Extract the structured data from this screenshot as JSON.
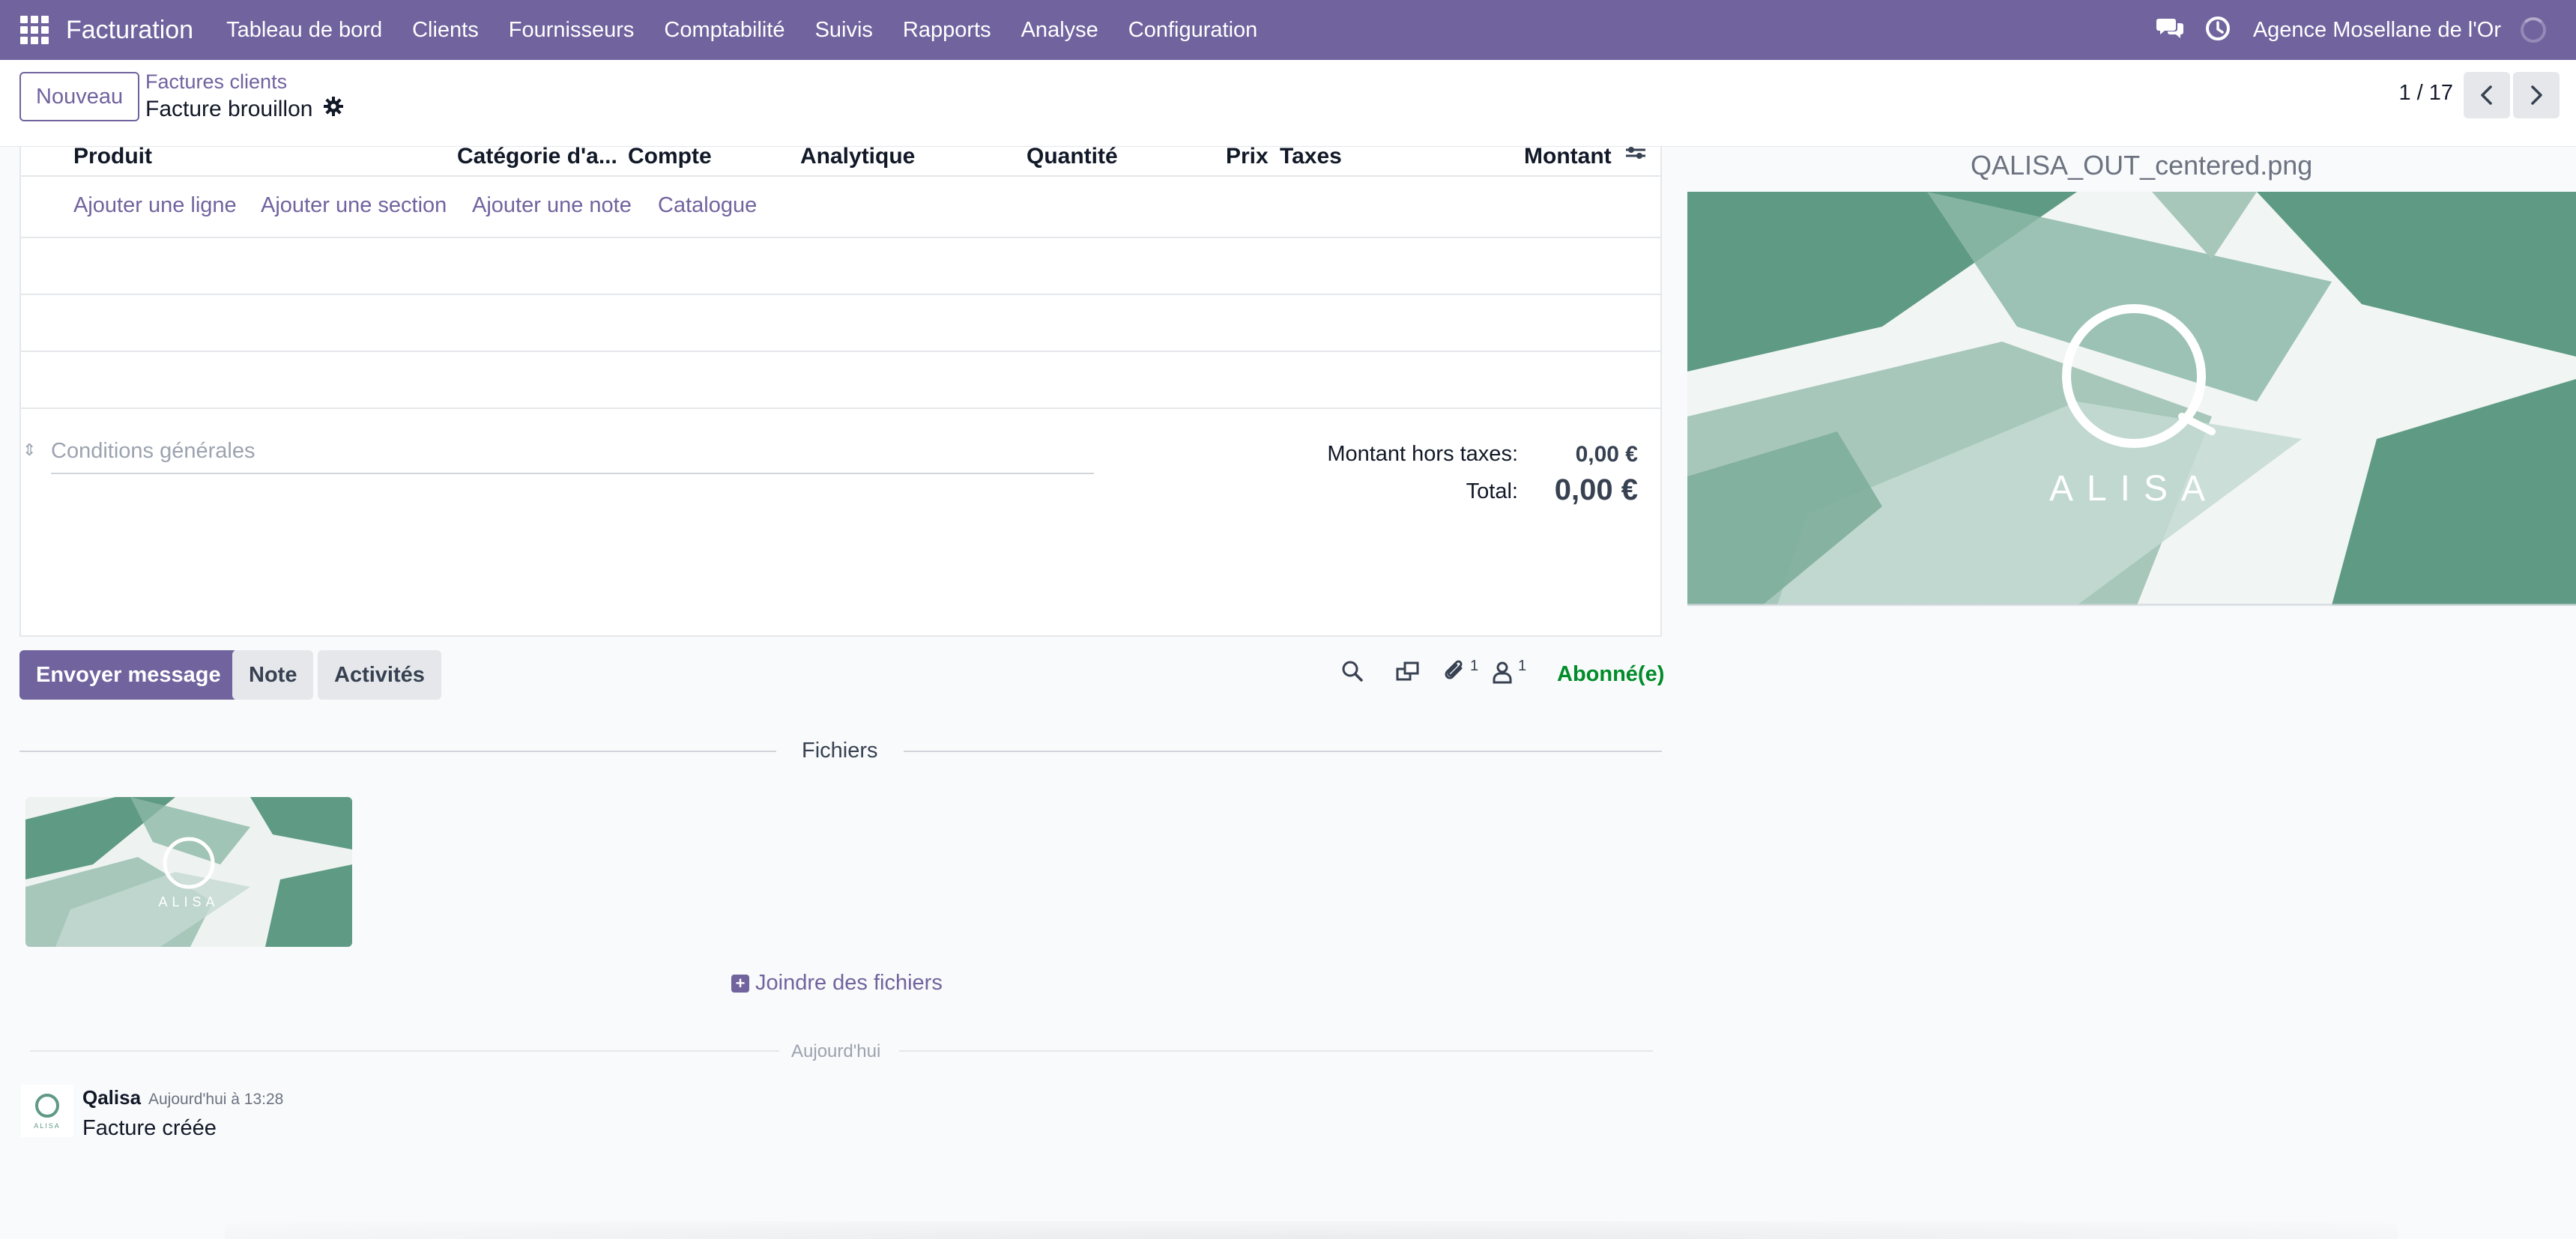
{
  "navbar": {
    "brand": "Facturation",
    "menu": [
      "Tableau de bord",
      "Clients",
      "Fournisseurs",
      "Comptabilité",
      "Suivis",
      "Rapports",
      "Analyse",
      "Configuration"
    ],
    "company": "Agence Mosellane de l'Or"
  },
  "control": {
    "new_label": "Nouveau",
    "breadcrumb_parent": "Factures clients",
    "breadcrumb_current": "Facture brouillon",
    "pager": "1 / 17"
  },
  "lines": {
    "columns": [
      "Produit",
      "Catégorie d'a...",
      "Compte",
      "Analytique",
      "Quantité",
      "Prix",
      "Taxes",
      "Montant"
    ],
    "add_line": "Ajouter une ligne",
    "add_section": "Ajouter une section",
    "add_note": "Ajouter une note",
    "catalog": "Catalogue"
  },
  "terms_placeholder": "Conditions générales",
  "totals": {
    "untaxed_label": "Montant hors taxes:",
    "untaxed_value": "0,00 €",
    "total_label": "Total:",
    "total_value": "0,00 €"
  },
  "chatter": {
    "send_label": "Envoyer message",
    "note_label": "Note",
    "activities_label": "Activités",
    "attachments_count": "1",
    "followers_count": "1",
    "follow_label": "Abonné(e)",
    "files_label": "Fichiers",
    "attach_label": "Joindre des fichiers",
    "today_label": "Aujourd'hui",
    "message": {
      "author": "Qalisa",
      "time": "Aujourd'hui à 13:28",
      "body": "Facture créée"
    }
  },
  "preview": {
    "filename": "QALISA_OUT_centered.png",
    "logo_text": "ALISA"
  },
  "colors": {
    "brand": "#71639e",
    "follow": "#008c29",
    "logo_green": "#5e9a84"
  }
}
